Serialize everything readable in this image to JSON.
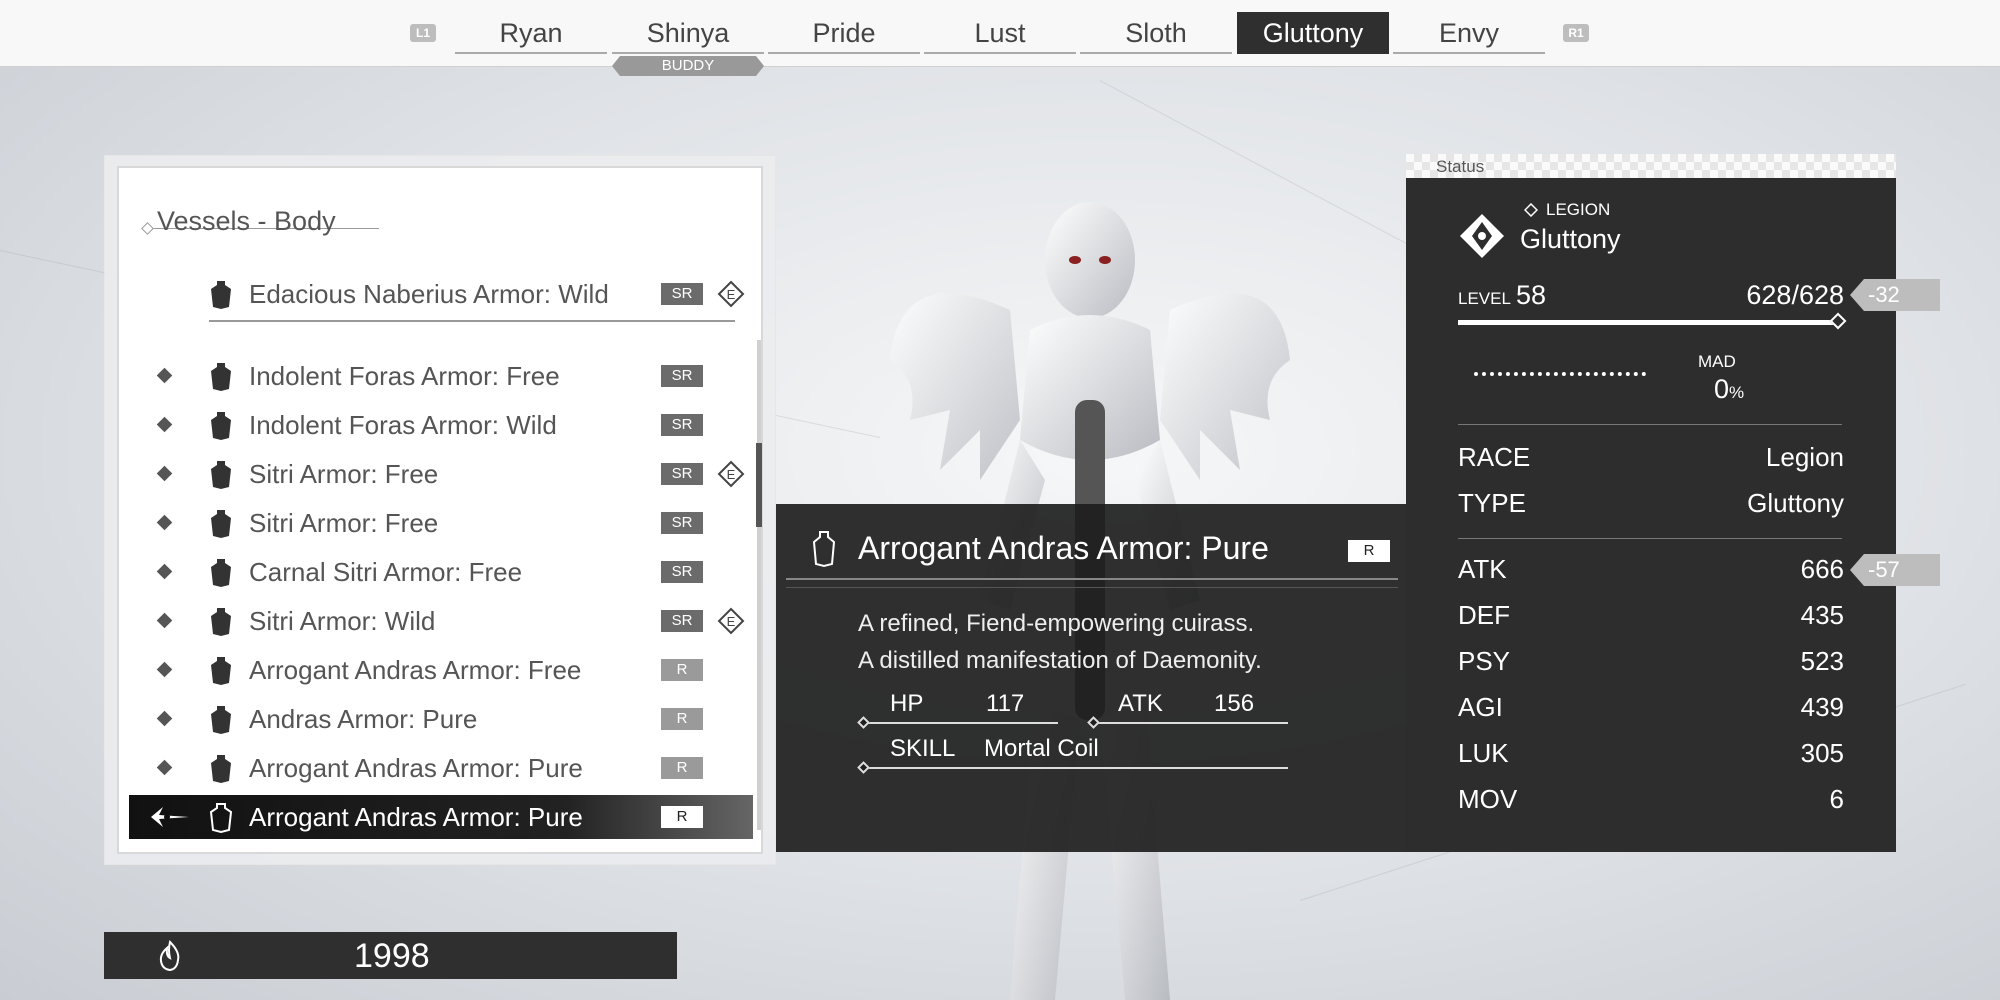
{
  "top_tabs": {
    "left_hint": "L1",
    "right_hint": "R1",
    "items": [
      {
        "label": "Ryan"
      },
      {
        "label": "Shinya"
      },
      {
        "label": "Pride"
      },
      {
        "label": "Lust"
      },
      {
        "label": "Sloth"
      },
      {
        "label": "Gluttony",
        "active": true
      },
      {
        "label": "Envy"
      }
    ],
    "buddy_label": "BUDDY"
  },
  "vessel_list": {
    "title": "Vessels - Body",
    "equipped": {
      "name": "Edacious Naberius Armor: Wild",
      "rank": "SR",
      "equipped_badge": "E"
    },
    "items": [
      {
        "name": "Indolent Foras Armor: Free",
        "rank": "SR"
      },
      {
        "name": "Indolent Foras Armor: Wild",
        "rank": "SR"
      },
      {
        "name": "Sitri Armor: Free",
        "rank": "SR",
        "equipped_badge": "E"
      },
      {
        "name": "Sitri Armor: Free",
        "rank": "SR"
      },
      {
        "name": "Carnal Sitri Armor: Free",
        "rank": "SR"
      },
      {
        "name": "Sitri Armor: Wild",
        "rank": "SR",
        "equipped_badge": "E"
      },
      {
        "name": "Arrogant Andras Armor: Free",
        "rank": "R"
      },
      {
        "name": "Andras Armor: Pure",
        "rank": "R"
      },
      {
        "name": "Arrogant Andras Armor: Pure",
        "rank": "R"
      },
      {
        "name": "Arrogant Andras Armor: Pure",
        "rank": "R",
        "selected": true
      }
    ]
  },
  "currency": {
    "value": "1998",
    "icon": "flame-icon"
  },
  "item_detail": {
    "name": "Arrogant Andras Armor: Pure",
    "rank": "R",
    "description_line1": "A refined, Fiend-empowering cuirass.",
    "description_line2": "A distilled manifestation of Daemonity.",
    "hp_label": "HP",
    "hp_value": "117",
    "atk_label": "ATK",
    "atk_value": "156",
    "skill_label": "SKILL",
    "skill_value": "Mortal Coil"
  },
  "status": {
    "header": "Status",
    "race_badge": "LEGION",
    "name": "Gluttony",
    "level_label": "LEVEL",
    "level": "58",
    "hp": "628/628",
    "hp_fraction": 1.0,
    "hp_delta": "-32",
    "mad_label": "MAD",
    "mad_value": "0",
    "mad_unit": "%",
    "race_label": "RACE",
    "race_value": "Legion",
    "type_label": "TYPE",
    "type_value": "Gluttony",
    "stats": [
      {
        "label": "ATK",
        "value": "666",
        "delta": "-57"
      },
      {
        "label": "DEF",
        "value": "435"
      },
      {
        "label": "PSY",
        "value": "523"
      },
      {
        "label": "AGI",
        "value": "439"
      },
      {
        "label": "LUK",
        "value": "305"
      },
      {
        "label": "MOV",
        "value": "6"
      }
    ]
  },
  "colors": {
    "panel_dark": "#2d2d2d",
    "accent_light": "#ffffff",
    "rank_sr": "#6b6b6b",
    "rank_r": "#9a9a9a"
  }
}
